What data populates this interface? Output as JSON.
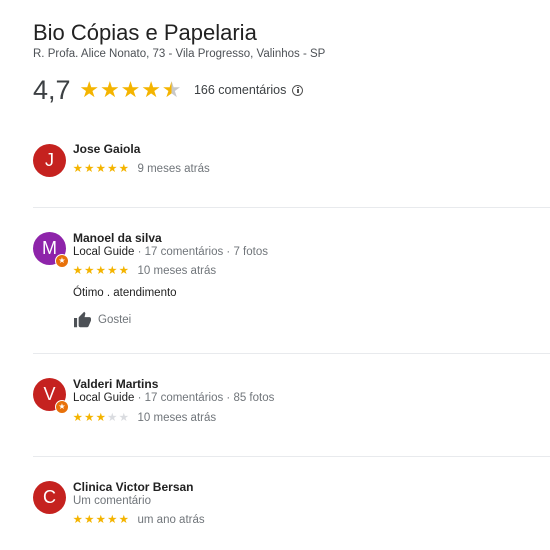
{
  "business": {
    "name": "Bio Cópias e Papelaria",
    "address": "R. Profa. Alice Nonato, 73 - Vila Progresso, Valinhos - SP",
    "rating": "4,7",
    "rating_value": 4.7,
    "review_count": "166 comentários"
  },
  "colors": {
    "star": "#f4b400",
    "star_off": "#dadce0",
    "guide_badge": "#e8710a"
  },
  "icons": {
    "rating_info": "info-icon",
    "like": "thumbs-up-icon",
    "guide_badge": "local-guide-star-icon"
  },
  "reviews": [
    {
      "avatar_letter": "J",
      "avatar_color": "#c5221f",
      "name": "Jose Gaiola",
      "stars": 5,
      "date": "9 meses atrás"
    },
    {
      "avatar_letter": "M",
      "avatar_color": "#8e24aa",
      "name": "Manoel da silva",
      "meta_guide": "Local Guide",
      "meta_counts": " · 17 comentários · 7 fotos",
      "stars": 5,
      "date": "10 meses atrás",
      "text": "Ótimo . atendimento",
      "like_label": "Gostei"
    },
    {
      "avatar_letter": "V",
      "avatar_color": "#c5221f",
      "name": "Valderi Martins",
      "meta_guide": "Local Guide",
      "meta_counts": " · 17 comentários · 85 fotos",
      "stars": 3,
      "date": "10 meses atrás"
    },
    {
      "avatar_letter": "C",
      "avatar_color": "#c5221f",
      "name": "Clinica Victor Bersan",
      "meta": "Um comentário",
      "stars": 5,
      "date": "um ano atrás"
    }
  ]
}
